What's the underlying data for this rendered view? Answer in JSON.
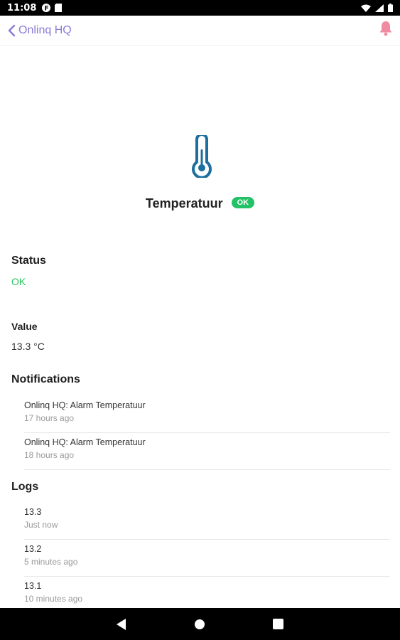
{
  "status_bar": {
    "time": "11:08"
  },
  "app_bar": {
    "back_label": "Onlinq HQ"
  },
  "sensor": {
    "name": "Temperatuur",
    "status_badge": "OK",
    "icon": "thermometer-icon"
  },
  "status_section": {
    "label": "Status",
    "value": "OK"
  },
  "value_section": {
    "label": "Value",
    "value": "13.3 °C"
  },
  "notifications": {
    "heading": "Notifications",
    "items": [
      {
        "title": "Onlinq HQ: Alarm Temperatuur",
        "time": "17 hours ago"
      },
      {
        "title": "Onlinq HQ: Alarm Temperatuur",
        "time": "18 hours ago"
      }
    ]
  },
  "logs": {
    "heading": "Logs",
    "items": [
      {
        "value": "13.3",
        "time": "Just now"
      },
      {
        "value": "13.2",
        "time": "5 minutes ago"
      },
      {
        "value": "13.1",
        "time": "10 minutes ago"
      }
    ]
  },
  "colors": {
    "accent": "#8b7ad8",
    "ok_green": "#23c266",
    "bell_pink": "#f08aa0",
    "thermometer_blue": "#1f6f9e"
  }
}
